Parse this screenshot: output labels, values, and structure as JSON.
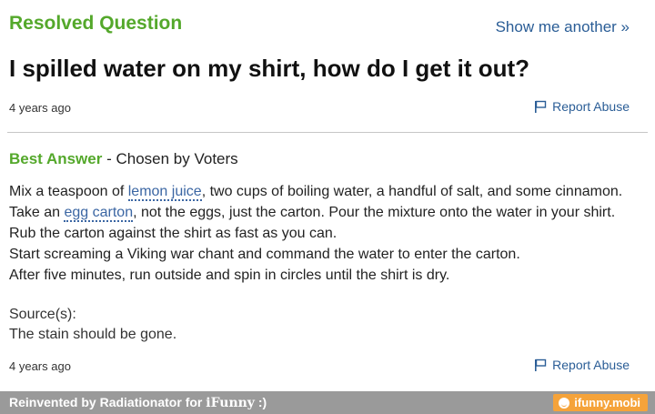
{
  "header": {
    "status": "Resolved Question",
    "show_another": "Show me another »"
  },
  "question": {
    "title": "I spilled water on my shirt, how do I get it out?",
    "age": "4 years ago",
    "report": "Report Abuse"
  },
  "best_answer": {
    "label": "Best Answer",
    "chosen_by": " - Chosen by Voters",
    "lines": {
      "l1_pre": "Mix a teaspoon of ",
      "l1_link": "lemon juice",
      "l1_post": ", two cups of boiling water, a handful of salt, and some cinnamon.",
      "l2_pre": "Take an ",
      "l2_link": "egg carton",
      "l2_post": ", not the eggs, just the carton. Pour the mixture onto the water in your shirt. Rub the carton against the shirt as fast as you can.",
      "l3": "Start screaming a Viking war chant and command the water to enter the carton.",
      "l4": "After five minutes, run outside and spin in circles until the shirt is dry."
    },
    "sources_label": "Source(s):",
    "source": "The stain should be gone.",
    "age": "4 years ago",
    "report": "Report Abuse"
  },
  "footer": {
    "credit_prefix": "Reinvented by Radiationator for ",
    "credit_brand": "iFunny",
    "credit_suffix": " :)",
    "site": "ifunny.mobi"
  },
  "colors": {
    "green": "#54a82b",
    "link_blue": "#2a5d96",
    "footer_gray": "#9a9a9a",
    "badge_orange": "#f5a33a"
  },
  "icons": [
    "flag-icon",
    "smiley-icon"
  ]
}
